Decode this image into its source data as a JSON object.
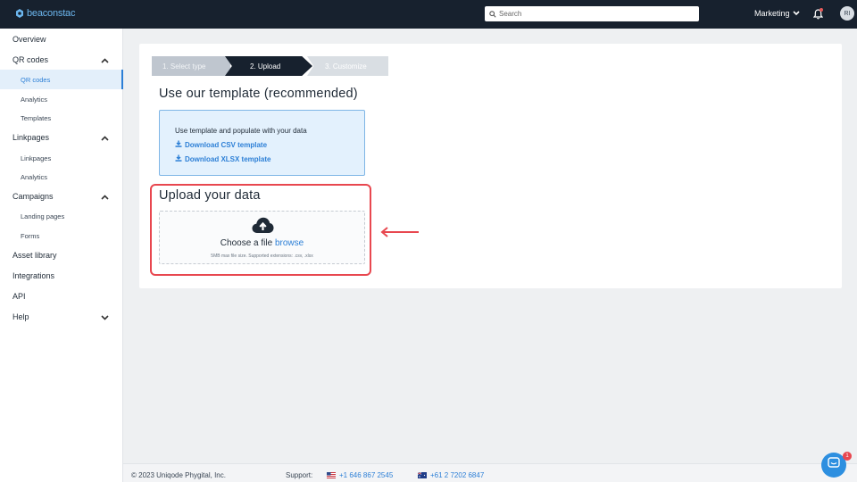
{
  "topbar": {
    "logo_text": "beaconstac",
    "search_placeholder": "Search",
    "workspace": "Marketing",
    "avatar_initials": "RI",
    "brand_color": "#6cb6ee",
    "bg_color": "#17212e"
  },
  "sidebar": {
    "items": [
      {
        "label": "Overview",
        "level": "top"
      },
      {
        "label": "QR codes",
        "level": "top",
        "chevron": "up"
      },
      {
        "label": "QR codes",
        "level": "sub",
        "active": true
      },
      {
        "label": "Analytics",
        "level": "sub"
      },
      {
        "label": "Templates",
        "level": "sub"
      },
      {
        "label": "Linkpages",
        "level": "top",
        "chevron": "up"
      },
      {
        "label": "Linkpages",
        "level": "sub"
      },
      {
        "label": "Analytics",
        "level": "sub"
      },
      {
        "label": "Campaigns",
        "level": "top",
        "chevron": "up"
      },
      {
        "label": "Landing pages",
        "level": "sub"
      },
      {
        "label": "Forms",
        "level": "sub"
      },
      {
        "label": "Asset library",
        "level": "top"
      },
      {
        "label": "Integrations",
        "level": "top"
      },
      {
        "label": "API",
        "level": "top"
      },
      {
        "label": "Help",
        "level": "top",
        "chevron": "down"
      }
    ]
  },
  "steps": [
    {
      "label": "1. Select type",
      "state": "done"
    },
    {
      "label": "2. Upload",
      "state": "current"
    },
    {
      "label": "3. Customize",
      "state": "pending"
    }
  ],
  "template_section": {
    "heading": "Use our template (recommended)",
    "intro": "Use template and populate with your data",
    "csv_link": "Download CSV template",
    "xlsx_link": "Download XLSX template"
  },
  "upload_section": {
    "heading": "Upload your data",
    "choose_text": "Choose a file",
    "browse_text": "browse",
    "note": "5MB max file size. Supported extensions: .csv, .xlsx",
    "highlight_color": "#e8474f"
  },
  "footer": {
    "copyright": "© 2023 Uniqode Phygital, Inc.",
    "support_label": "Support:",
    "phone_us": "+1 646 867 2545",
    "phone_au": "+61 2 7202 6847"
  },
  "chat": {
    "badge_count": "1"
  }
}
